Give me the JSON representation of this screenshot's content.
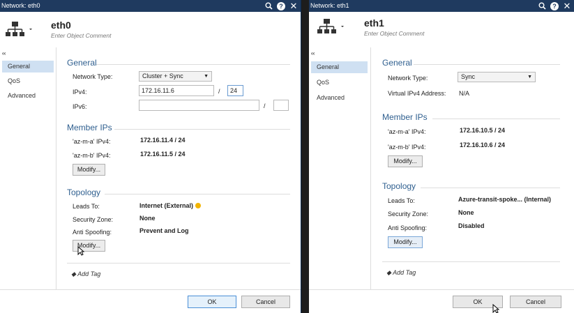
{
  "left": {
    "title": "Network: eth0",
    "name": "eth0",
    "comment_placeholder": "Enter Object Comment",
    "collapse": "‹‹",
    "sidebar": [
      "General",
      "QoS",
      "Advanced"
    ],
    "general": {
      "title": "General",
      "network_type_label": "Network Type:",
      "network_type_value": "Cluster + Sync",
      "ipv4_label": "IPv4:",
      "ipv4_value": "172.16.11.6",
      "ipv4_mask": "24",
      "ipv6_label": "IPv6:",
      "ipv6_value": "",
      "ipv6_mask": "",
      "slash": "/"
    },
    "member": {
      "title": "Member IPs",
      "rows": [
        {
          "label": "'az-m-a' IPv4:",
          "value": "172.16.11.4 / 24"
        },
        {
          "label": "'az-m-b' IPv4:",
          "value": "172.16.11.5 / 24"
        }
      ],
      "modify": "Modify..."
    },
    "topology": {
      "title": "Topology",
      "leads_label": "Leads To:",
      "leads_value": "Internet (External)",
      "zone_label": "Security Zone:",
      "zone_value": "None",
      "spoof_label": "Anti Spoofing:",
      "spoof_value": "Prevent and Log",
      "modify": "Modify..."
    },
    "add_tag": "Add Tag",
    "ok": "OK",
    "cancel": "Cancel"
  },
  "right": {
    "title": "Network: eth1",
    "name": "eth1",
    "comment_placeholder": "Enter Object Comment",
    "collapse": "‹‹",
    "sidebar": [
      "General",
      "QoS",
      "Advanced"
    ],
    "general": {
      "title": "General",
      "network_type_label": "Network Type:",
      "network_type_value": "Sync",
      "vip_label": "Virtual IPv4 Address:",
      "vip_value": "N/A"
    },
    "member": {
      "title": "Member IPs",
      "rows": [
        {
          "label": "'az-m-a' IPv4:",
          "value": "172.16.10.5 / 24"
        },
        {
          "label": "'az-m-b' IPv4:",
          "value": "172.16.10.6 / 24"
        }
      ],
      "modify": "Modify..."
    },
    "topology": {
      "title": "Topology",
      "leads_label": "Leads To:",
      "leads_value": "Azure-transit-spoke... (Internal)",
      "zone_label": "Security Zone:",
      "zone_value": "None",
      "spoof_label": "Anti Spoofing:",
      "spoof_value": "Disabled",
      "modify": "Modify..."
    },
    "add_tag": "Add Tag",
    "ok": "OK",
    "cancel": "Cancel"
  },
  "colors": {
    "titlebar": "#1f3a5f",
    "section": "#2f5f8f",
    "sidebar_active": "#cfe0f2"
  }
}
